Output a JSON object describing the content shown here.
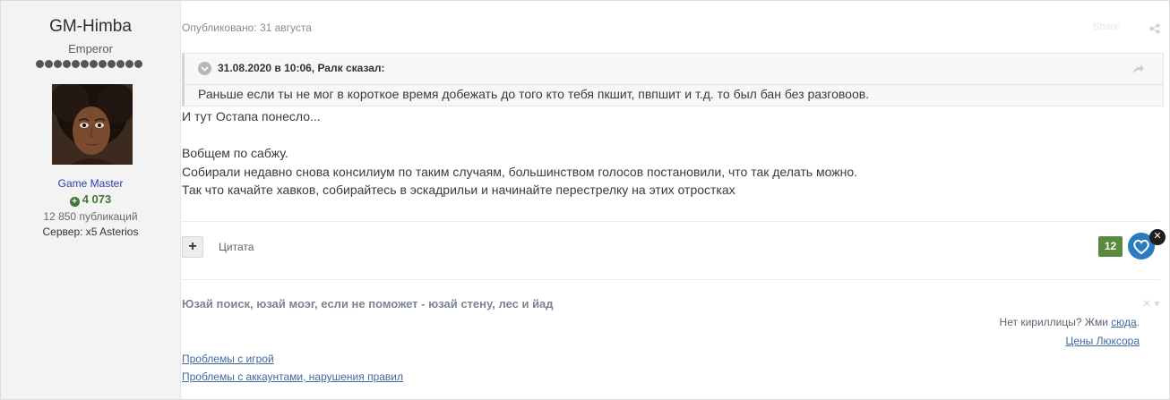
{
  "author": {
    "name": "GM-Himba",
    "rank": "Emperor",
    "rank_dots": 12,
    "group": "Game Master",
    "reputation": "4 073",
    "post_count": "12 850 публикаций",
    "server": "Сервер: x5 Asterios"
  },
  "post": {
    "published": "Опубликовано: 31 августа",
    "share_label": "Share",
    "quote": {
      "header": "31.08.2020 в 10:06, Ралк сказал:",
      "text": "Раньше если ты не мог в короткое время добежать до того кто тебя пкшит, пвпшит и т.д. то был бан без разговоов."
    },
    "lines": [
      "И тут Остапа понесло...",
      "",
      "Вобщем по сабжу.",
      "Собирали недавно снова консилиум по таким случаям, большинством голосов постановили, что так делать можно.",
      "Так что качайте хавков, собирайтесь в эскадрильи и начинайте перестрелку на этих отростках"
    ],
    "quote_button": "Цитата",
    "reaction_count": "12"
  },
  "signature": {
    "text": "Юзай поиск, юзай моэг, если не поможет - юзай стену, лес и йад",
    "cyrillic_prefix": "Нет кириллицы? Жми ",
    "cyrillic_link": "сюда",
    "cyrillic_suffix": ".",
    "prices_link": "Цены Люксора",
    "link1": "Проблемы с игрой",
    "link2": "Проблемы с аккаунтами, нарушения правил"
  }
}
